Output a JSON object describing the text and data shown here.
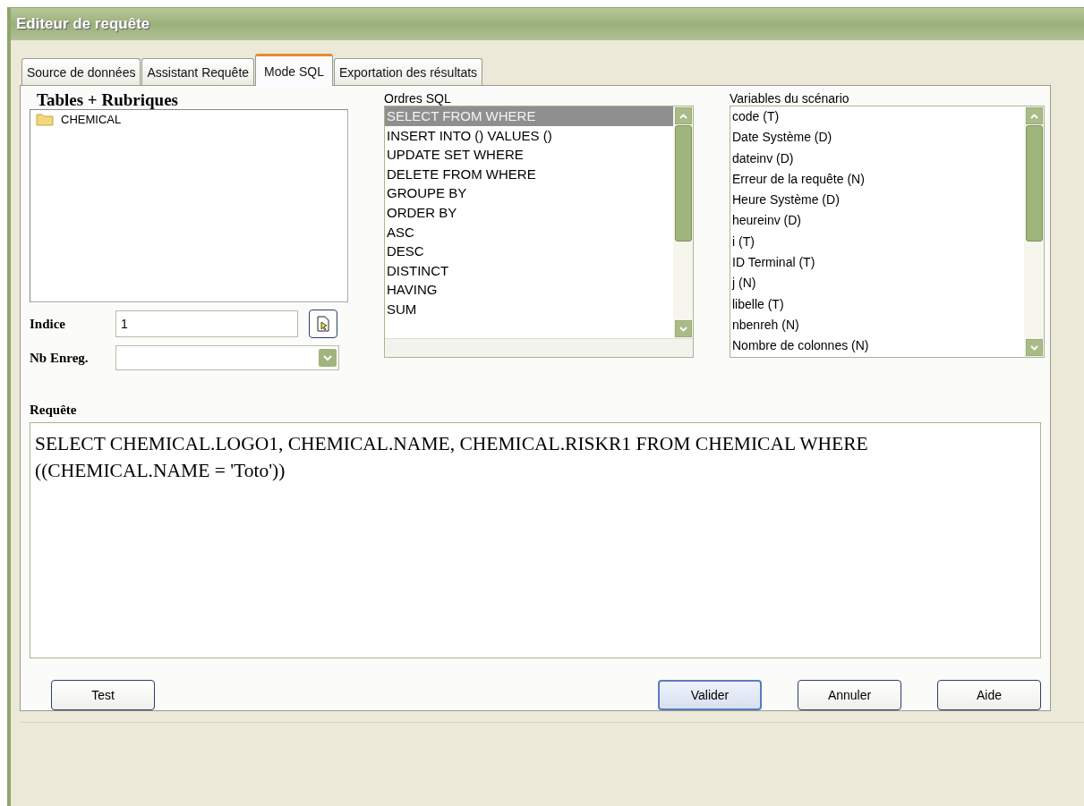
{
  "window": {
    "title": "Editeur de requête"
  },
  "tabs": [
    {
      "label": "Source de données",
      "selected": false
    },
    {
      "label": "Assistant Requête",
      "selected": false
    },
    {
      "label": "Mode SQL",
      "selected": true
    },
    {
      "label": "Exportation des résultats",
      "selected": false
    }
  ],
  "tables_panel": {
    "title": "Tables + Rubriques",
    "items": [
      {
        "label": "CHEMICAL"
      }
    ]
  },
  "indice": {
    "label": "Indice",
    "value": "1"
  },
  "nb_enreg": {
    "label": "Nb Enreg."
  },
  "sql_orders": {
    "title": "Ordres SQL",
    "items": [
      {
        "label": "SELECT  FROM  WHERE",
        "selected": true
      },
      {
        "label": "INSERT INTO  () VALUES ()",
        "selected": false
      },
      {
        "label": "UPDATE  SET  WHERE",
        "selected": false
      },
      {
        "label": "DELETE FROM  WHERE",
        "selected": false
      },
      {
        "label": "GROUPE BY",
        "selected": false
      },
      {
        "label": "ORDER BY",
        "selected": false
      },
      {
        "label": "ASC",
        "selected": false
      },
      {
        "label": "DESC",
        "selected": false
      },
      {
        "label": "DISTINCT",
        "selected": false
      },
      {
        "label": "HAVING",
        "selected": false
      },
      {
        "label": "SUM",
        "selected": false
      }
    ]
  },
  "variables": {
    "title": "Variables du scénario",
    "items": [
      "code (T)",
      "Date Système (D)",
      "dateinv (D)",
      "Erreur de la requête (N)",
      "Heure Système (D)",
      "heureinv (D)",
      "i (T)",
      "ID Terminal (T)",
      "j (N)",
      "libelle (T)",
      "nbenreh (N)",
      "Nombre de colonnes (N)"
    ]
  },
  "query": {
    "label": "Requête",
    "value": "SELECT CHEMICAL.LOGO1, CHEMICAL.NAME, CHEMICAL.RISKR1 FROM CHEMICAL WHERE ((CHEMICAL.NAME = 'Toto'))"
  },
  "buttons": [
    {
      "label": "Test",
      "default": false
    },
    {
      "label": "Valider",
      "default": true
    },
    {
      "label": "Annuler",
      "default": false
    },
    {
      "label": "Aide",
      "default": false
    }
  ]
}
